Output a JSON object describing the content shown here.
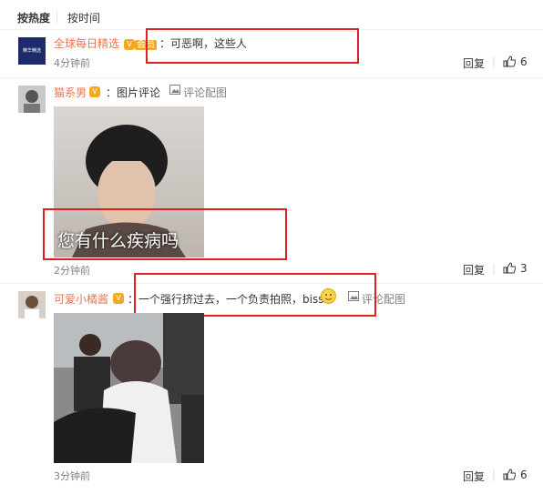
{
  "sort": {
    "hot": "按热度",
    "time": "按时间"
  },
  "comments": [
    {
      "username": "全球每日精选",
      "avatar_text": "精华精选",
      "vip_badge": "会员",
      "text": "可恶啊，这些人",
      "time": "4分钟前",
      "reply": "回复",
      "likes": "6"
    },
    {
      "username": "猫系男",
      "text": "图片评论",
      "pic_link": "评论配图",
      "image_caption": "您有什么疾病吗",
      "time": "2分钟前",
      "reply": "回复",
      "likes": "3"
    },
    {
      "username": "可爱小橘酱",
      "text": "一个强行挤过去，一个负责拍照，biss",
      "pic_link": "评论配图",
      "time": "3分钟前",
      "reply": "回复",
      "likes": "6"
    }
  ],
  "colors": {
    "username": "#eb7350",
    "highlight": "#e02020",
    "badge": "#f5a623"
  }
}
